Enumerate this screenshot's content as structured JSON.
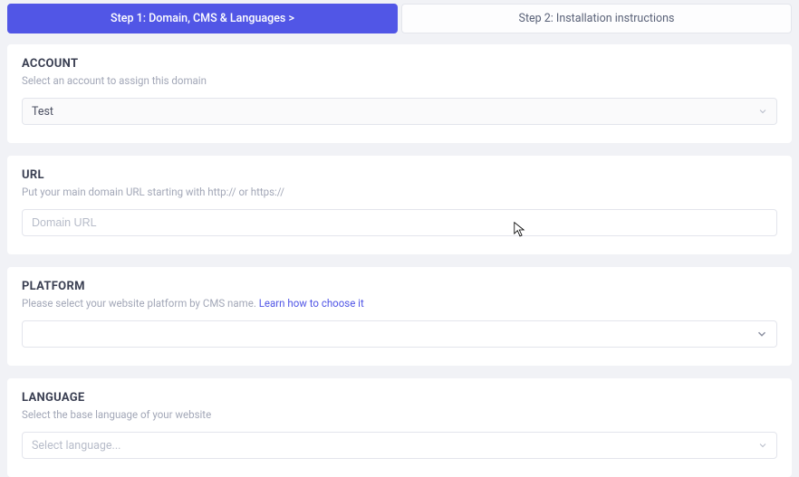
{
  "tabs": {
    "step1": "Step 1: Domain, CMS & Languages  >",
    "step2": "Step 2: Installation instructions"
  },
  "account": {
    "title": "ACCOUNT",
    "desc": "Select an account to assign this domain",
    "value": "Test"
  },
  "url": {
    "title": "URL",
    "desc": "Put your main domain URL starting with http:// or https://",
    "placeholder": "Domain URL"
  },
  "platform": {
    "title": "PLATFORM",
    "desc": "Please select your website platform by CMS name. ",
    "link": "Learn how to choose it",
    "value": ""
  },
  "language": {
    "title": "LANGUAGE",
    "desc": "Select the base language of your website",
    "placeholder": "Select language..."
  }
}
